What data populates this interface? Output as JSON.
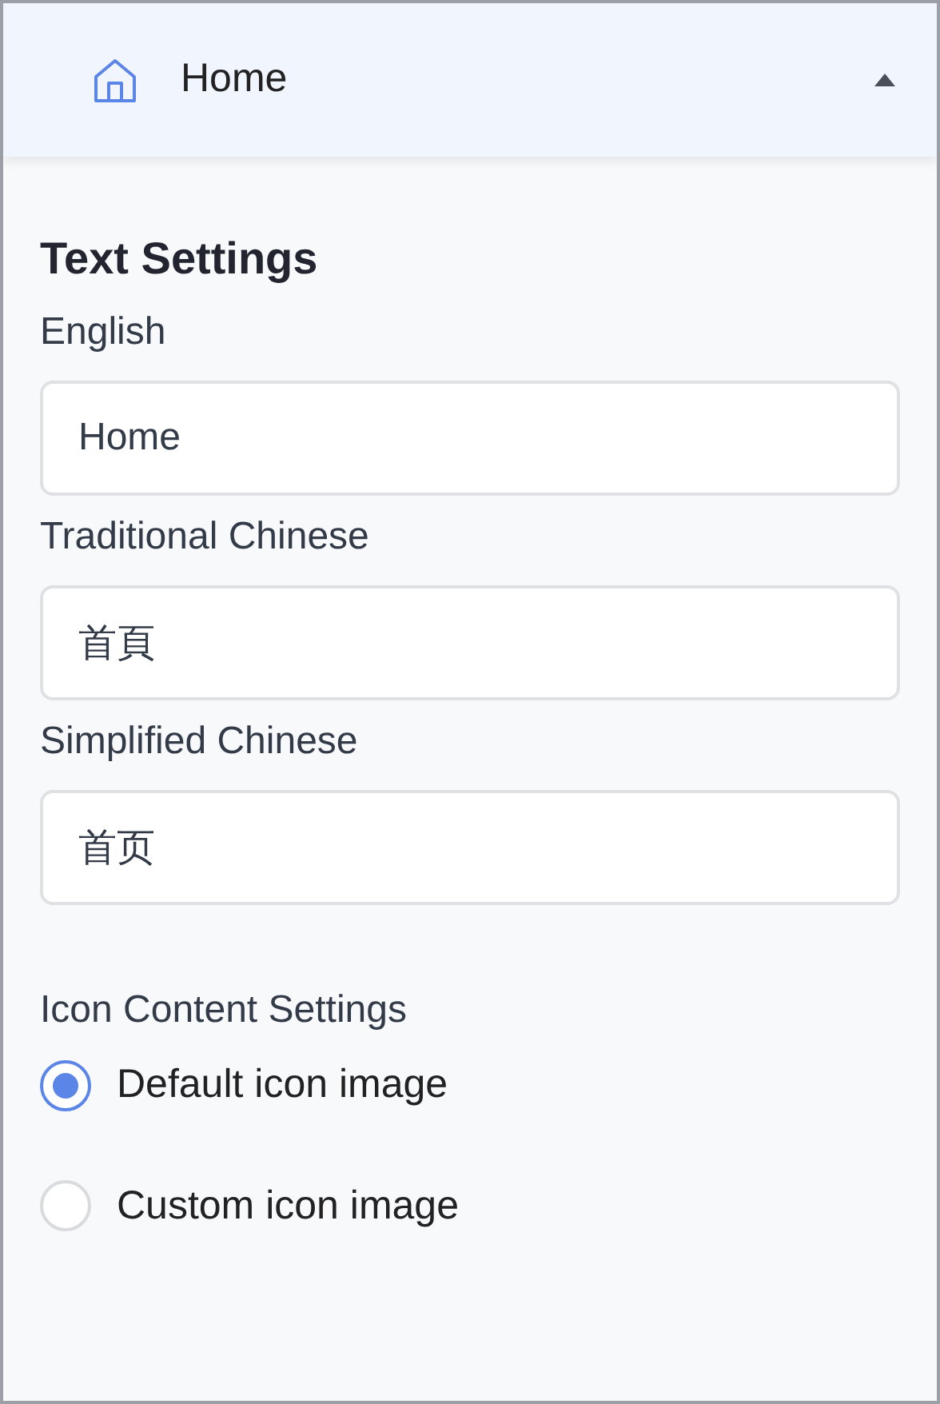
{
  "menu_item": {
    "label": "Home",
    "expanded": true
  },
  "text_settings": {
    "title": "Text Settings",
    "fields": [
      {
        "label": "English",
        "value": "Home"
      },
      {
        "label": "Traditional Chinese",
        "value": "首頁"
      },
      {
        "label": "Simplified Chinese",
        "value": "首页"
      }
    ]
  },
  "icon_settings": {
    "title": "Icon Content Settings",
    "options": [
      {
        "label": "Default icon image",
        "selected": true
      },
      {
        "label": "Custom icon image",
        "selected": false
      }
    ]
  }
}
